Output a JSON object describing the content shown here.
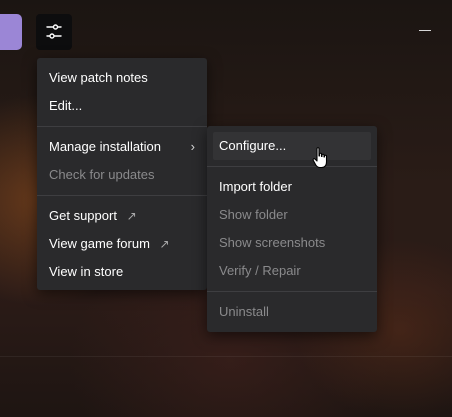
{
  "main_menu": {
    "items": [
      {
        "label": "View patch notes"
      },
      {
        "label": "Edit..."
      },
      {
        "label": "Manage installation"
      },
      {
        "label": "Check for updates"
      },
      {
        "label": "Get support"
      },
      {
        "label": "View game forum"
      },
      {
        "label": "View in store"
      }
    ]
  },
  "sub_menu": {
    "items": [
      {
        "label": "Configure..."
      },
      {
        "label": "Import folder"
      },
      {
        "label": "Show folder"
      },
      {
        "label": "Show screenshots"
      },
      {
        "label": "Verify / Repair"
      },
      {
        "label": "Uninstall"
      }
    ]
  },
  "icons": {
    "settings": "sliders-icon",
    "external": "external-link-icon",
    "submenu": "chevron-right-icon",
    "cursor": "hand-pointer-icon"
  },
  "colors": {
    "accent": "#9b86d6",
    "menu_bg": "#2a2a2c",
    "disabled_text": "#8a8a8c"
  }
}
